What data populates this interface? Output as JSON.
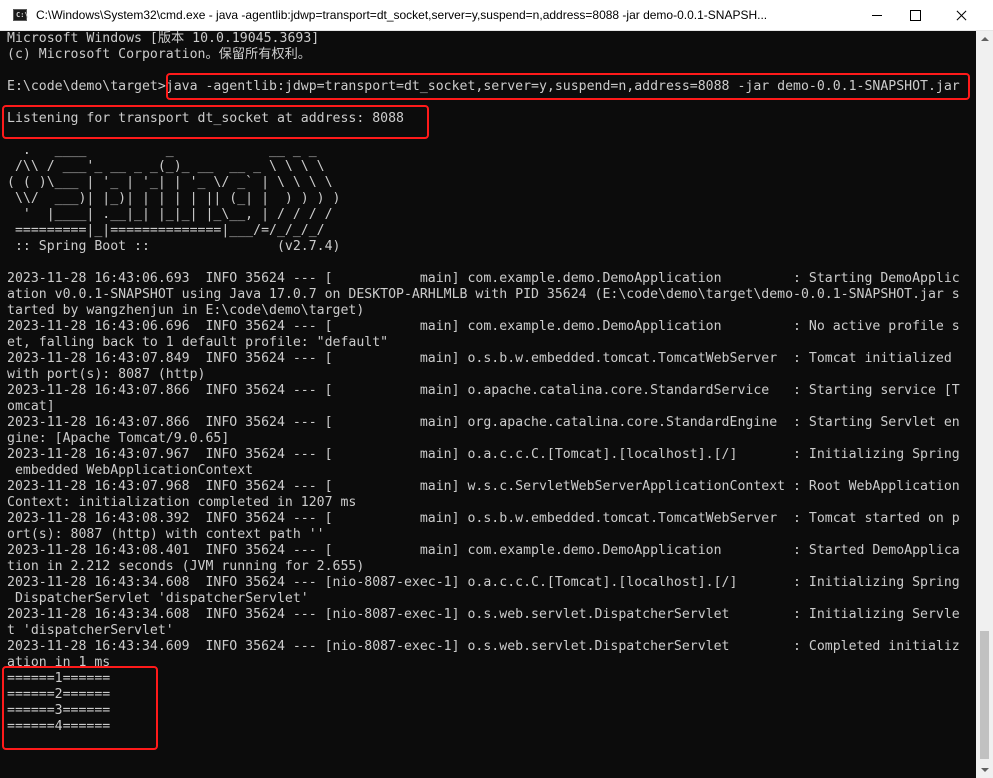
{
  "window": {
    "title": "C:\\Windows\\System32\\cmd.exe - java  -agentlib:jdwp=transport=dt_socket,server=y,suspend=n,address=8088 -jar demo-0.0.1-SNAPSH...",
    "icon": "cmd-icon",
    "icon_text": "C:\\"
  },
  "console": {
    "lines": [
      "Microsoft Windows [版本 10.0.19045.3693]",
      "(c) Microsoft Corporation。保留所有权利。",
      "",
      "E:\\code\\demo\\target>java -agentlib:jdwp=transport=dt_socket,server=y,suspend=n,address=8088 -jar demo-0.0.1-SNAPSHOT.jar",
      "",
      "Listening for transport dt_socket at address: 8088",
      "",
      "  .   ____          _            __ _ _",
      " /\\\\ / ___'_ __ _ _(_)_ __  __ _ \\ \\ \\ \\",
      "( ( )\\___ | '_ | '_| | '_ \\/ _` | \\ \\ \\ \\",
      " \\\\/  ___)| |_)| | | | | || (_| |  ) ) ) )",
      "  '  |____| .__|_| |_|_| |_\\__, | / / / /",
      " =========|_|==============|___/=/_/_/_/",
      " :: Spring Boot ::                (v2.7.4)",
      "",
      "2023-11-28 16:43:06.693  INFO 35624 --- [           main] com.example.demo.DemoApplication         : Starting DemoApplic",
      "ation v0.0.1-SNAPSHOT using Java 17.0.7 on DESKTOP-ARHLMLB with PID 35624 (E:\\code\\demo\\target\\demo-0.0.1-SNAPSHOT.jar s",
      "tarted by wangzhenjun in E:\\code\\demo\\target)",
      "2023-11-28 16:43:06.696  INFO 35624 --- [           main] com.example.demo.DemoApplication         : No active profile s",
      "et, falling back to 1 default profile: \"default\"",
      "2023-11-28 16:43:07.849  INFO 35624 --- [           main] o.s.b.w.embedded.tomcat.TomcatWebServer  : Tomcat initialized",
      "with port(s): 8087 (http)",
      "2023-11-28 16:43:07.866  INFO 35624 --- [           main] o.apache.catalina.core.StandardService   : Starting service [T",
      "omcat]",
      "2023-11-28 16:43:07.866  INFO 35624 --- [           main] org.apache.catalina.core.StandardEngine  : Starting Servlet en",
      "gine: [Apache Tomcat/9.0.65]",
      "2023-11-28 16:43:07.967  INFO 35624 --- [           main] o.a.c.c.C.[Tomcat].[localhost].[/]       : Initializing Spring",
      " embedded WebApplicationContext",
      "2023-11-28 16:43:07.968  INFO 35624 --- [           main] w.s.c.ServletWebServerApplicationContext : Root WebApplication",
      "Context: initialization completed in 1207 ms",
      "2023-11-28 16:43:08.392  INFO 35624 --- [           main] o.s.b.w.embedded.tomcat.TomcatWebServer  : Tomcat started on p",
      "ort(s): 8087 (http) with context path ''",
      "2023-11-28 16:43:08.401  INFO 35624 --- [           main] com.example.demo.DemoApplication         : Started DemoApplica",
      "tion in 2.212 seconds (JVM running for 2.655)",
      "2023-11-28 16:43:34.608  INFO 35624 --- [nio-8087-exec-1] o.a.c.c.C.[Tomcat].[localhost].[/]       : Initializing Spring",
      " DispatcherServlet 'dispatcherServlet'",
      "2023-11-28 16:43:34.608  INFO 35624 --- [nio-8087-exec-1] o.s.web.servlet.DispatcherServlet        : Initializing Servle",
      "t 'dispatcherServlet'",
      "2023-11-28 16:43:34.609  INFO 35624 --- [nio-8087-exec-1] o.s.web.servlet.DispatcherServlet        : Completed initializ",
      "ation in 1 ms",
      "======1======",
      "======2======",
      "======3======",
      "======4======",
      "_"
    ]
  },
  "colors": {
    "console_background": "#0c0c0c",
    "console_text": "#cccccc",
    "highlight_border": "#ff1a1a",
    "titlebar_background": "#ffffff"
  }
}
